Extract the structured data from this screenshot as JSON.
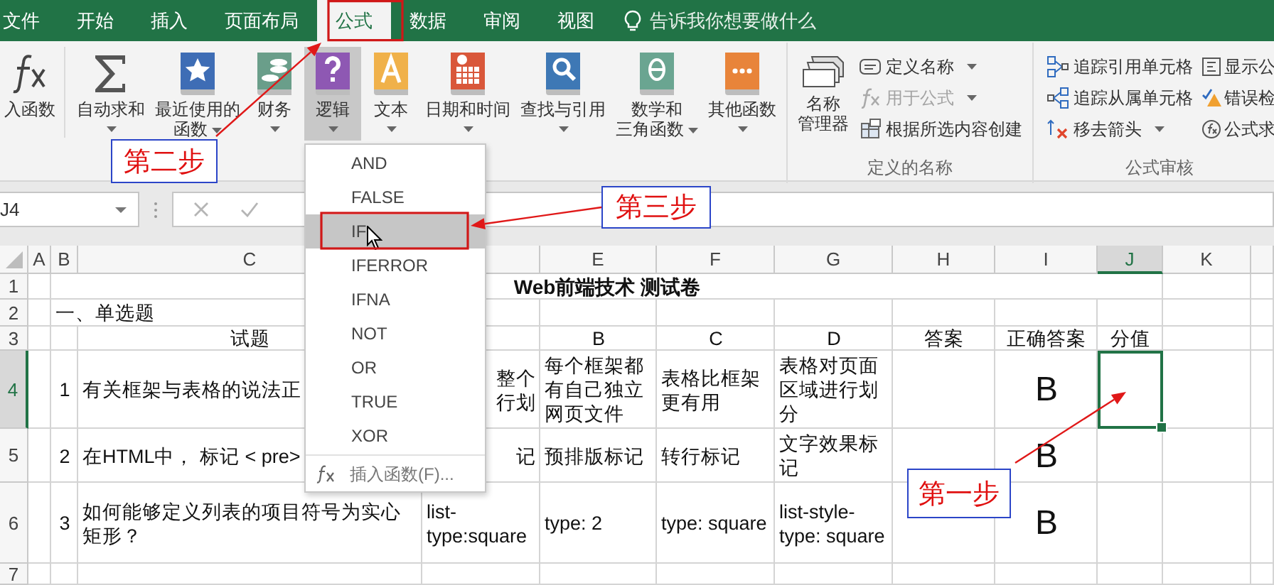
{
  "tabs": [
    {
      "label": "文件",
      "selected": false
    },
    {
      "label": "开始",
      "selected": false
    },
    {
      "label": "插入",
      "selected": false
    },
    {
      "label": "页面布局",
      "selected": false
    },
    {
      "label": "公式",
      "selected": true
    },
    {
      "label": "数据",
      "selected": false
    },
    {
      "label": "审阅",
      "selected": false
    },
    {
      "label": "视图",
      "selected": false
    }
  ],
  "tell_me": {
    "placeholder": "告诉我你想要做什么"
  },
  "ribbon": {
    "function_library": [
      {
        "label": "入函数",
        "dropdown": false,
        "pressed": false
      },
      {
        "label": "自动求和",
        "dropdown": true,
        "pressed": false
      },
      {
        "label": [
          "最近使用的",
          "函数"
        ],
        "dropdown": true,
        "pressed": false
      },
      {
        "label": "财务",
        "dropdown": true,
        "pressed": false
      },
      {
        "label": "逻辑",
        "dropdown": true,
        "pressed": true
      },
      {
        "label": "文本",
        "dropdown": true,
        "pressed": false
      },
      {
        "label": "日期和时间",
        "dropdown": true,
        "pressed": false
      },
      {
        "label": "查找与引用",
        "dropdown": true,
        "pressed": false
      },
      {
        "label": [
          "数学和",
          "三角函数"
        ],
        "dropdown": true,
        "pressed": false
      },
      {
        "label": "其他函数",
        "dropdown": true,
        "pressed": false
      }
    ],
    "name_manager": [
      "名称",
      "管理器"
    ],
    "defined_names": [
      {
        "label": "定义名称",
        "dropdown": true,
        "disabled": false
      },
      {
        "label": "用于公式",
        "dropdown": true,
        "disabled": true
      },
      {
        "label": "根据所选内容创建",
        "dropdown": false,
        "disabled": false
      }
    ],
    "defined_names_label": "定义的名称",
    "formula_auditing": [
      {
        "label": "追踪引用单元格",
        "dropdown": false
      },
      {
        "label": "追踪从属单元格",
        "dropdown": false
      },
      {
        "label": "移去箭头",
        "dropdown": true
      },
      {
        "label": "显示公",
        "dropdown": false
      },
      {
        "label": "错误检",
        "dropdown": false
      },
      {
        "label": "公式求",
        "dropdown": false
      }
    ],
    "formula_auditing_label": "公式审核"
  },
  "formula_bar": {
    "name_box": "J4"
  },
  "function_menu": {
    "items": [
      {
        "label": "AND",
        "selected": false
      },
      {
        "label": "FALSE",
        "selected": false
      },
      {
        "label": "IF",
        "selected": true
      },
      {
        "label": "IFERROR",
        "selected": false
      },
      {
        "label": "IFNA",
        "selected": false
      },
      {
        "label": "NOT",
        "selected": false
      },
      {
        "label": "OR",
        "selected": false
      },
      {
        "label": "TRUE",
        "selected": false
      },
      {
        "label": "XOR",
        "selected": false
      }
    ],
    "footer": "插入函数(F)..."
  },
  "sheet": {
    "columns": [
      {
        "label": "A",
        "selected": false
      },
      {
        "label": "B",
        "selected": false
      },
      {
        "label": "C",
        "selected": false
      },
      {
        "selected": false
      },
      {
        "label": "E",
        "selected": false
      },
      {
        "label": "F",
        "selected": false
      },
      {
        "label": "G",
        "selected": false
      },
      {
        "label": "H",
        "selected": false
      },
      {
        "label": "I",
        "selected": false
      },
      {
        "label": "J",
        "selected": true
      },
      {
        "label": "K",
        "selected": false
      }
    ],
    "rows": [
      {
        "number": "1",
        "selected": false,
        "title": "Web前端技术 测试卷"
      },
      {
        "number": "2",
        "selected": false,
        "section": "一、单选题"
      },
      {
        "number": "3",
        "selected": false,
        "cells": {
          "c": "试题",
          "e": "B",
          "f": "C",
          "g": "D",
          "h": "答案",
          "i": "正确答案",
          "j": "分值"
        }
      },
      {
        "number": "4",
        "selected": true,
        "cells": {
          "b": "1",
          "c": "有关框架与表格的说法正",
          "d": "整个行划",
          "e": "每个框架都有自己独立网页文件",
          "f": "表格比框架更有用",
          "g": "表格对页面区域进行划分",
          "i": "B"
        }
      },
      {
        "number": "5",
        "selected": false,
        "cells": {
          "b": "2",
          "c": "在HTML中， 标记 < pre>",
          "d": "记",
          "e": "预排版标记",
          "f": "转行标记",
          "g": "文字效果标记",
          "i": "B"
        }
      },
      {
        "number": "6",
        "selected": false,
        "cells": {
          "b": "3",
          "c": "如何能够定义列表的项目符号为实心矩形？",
          "d": "list-type:square",
          "e": "type: 2",
          "f": "type: square",
          "g": "list-style-type: square",
          "i": "B"
        }
      },
      {
        "number": "7",
        "selected": false
      }
    ]
  },
  "step_labels": [
    "第二步",
    "第三步",
    "第一步"
  ]
}
